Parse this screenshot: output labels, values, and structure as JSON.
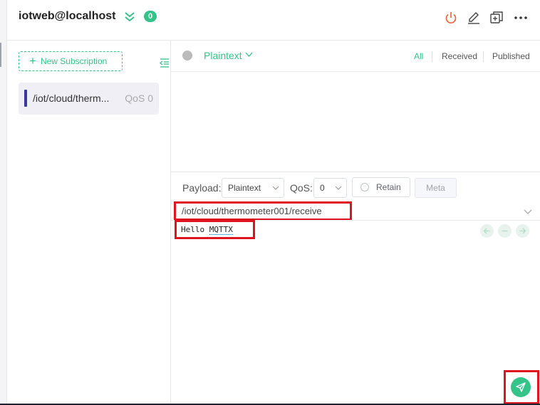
{
  "header": {
    "connection_name": "iotweb@localhost",
    "badge_count": "0"
  },
  "sidebar": {
    "new_subscription_label": "New Subscription",
    "subscriptions": [
      {
        "topic": "/iot/cloud/therm...",
        "qos": "QoS 0",
        "color": "#3a3a9a"
      }
    ]
  },
  "messages": {
    "payload_format": "Plaintext",
    "filters": {
      "all": "All",
      "received": "Received",
      "published": "Published"
    },
    "active_filter": "All"
  },
  "publish": {
    "payload_label": "Payload:",
    "payload_format": "Plaintext",
    "qos_label": "QoS:",
    "qos_value": "0",
    "retain_label": "Retain",
    "meta_label": "Meta",
    "topic": "/iot/cloud/thermometer001/receive",
    "payload_prefix": "Hello ",
    "payload_underlined": "MQTTX"
  },
  "colors": {
    "accent": "#34c388",
    "highlight": "#e0141e",
    "disconnect": "#e8603c"
  },
  "icons": [
    "double-chevron-down-icon",
    "power-icon",
    "edit-icon",
    "new-window-icon",
    "more-icon",
    "plus-icon",
    "collapse-icon",
    "chevron-down-icon",
    "arrow-left-icon",
    "minus-icon",
    "arrow-right-icon",
    "send-icon"
  ]
}
